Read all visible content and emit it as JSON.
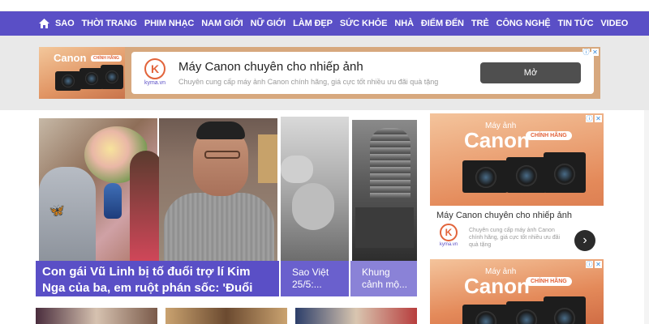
{
  "nav": {
    "items": [
      "SAO",
      "THỜI TRANG",
      "PHIM NHẠC",
      "NAM GIỚI",
      "NỮ GIỚI",
      "LÀM ĐẸP",
      "SỨC KHỎE",
      "NHÀ",
      "ĐIỂM ĐẾN",
      "TRẺ",
      "CÔNG NGHỆ",
      "TIN TỨC",
      "VIDEO"
    ],
    "home_icon": "home-icon",
    "bg_color": "#5a4fc6"
  },
  "top_ad": {
    "brand": "Canon",
    "badge": "CHÍNH HÃNG",
    "logo_letter": "K",
    "logo_text": "kyma.vn",
    "title": "Máy Canon chuyên cho nhiếp ảnh",
    "subtitle": "Chuyên cung cấp máy ảnh Canon chính hãng, giá cực tốt nhiều ưu đãi quà tặng",
    "open_label": "Mở"
  },
  "featured": {
    "main_caption": "Con gái Vũ Linh bị tố đuổi trợ lí Kim Nga của ba, em ruột phán sốc: 'Đuổi",
    "story_c_caption": "Sao Việt 25/5:...",
    "story_d_caption": "Khung cảnh mộ..."
  },
  "side_ad": {
    "small_label": "Máy ảnh",
    "brand": "Canon",
    "badge": "CHÍNH HÃNG",
    "title": "Máy Canon chuyên cho nhiếp ảnh",
    "description": "Chuyên cung cấp máy ảnh Canon chính hãng, giá cực tốt nhiều ưu đãi quà tặng",
    "logo_letter": "K",
    "logo_text": "kyma.vn"
  },
  "side_ad2": {
    "small_label": "Máy ảnh",
    "brand": "Canon",
    "badge": "CHÍNH HÃNG"
  },
  "colors": {
    "accent": "#5a4fc6",
    "ad_orange": "#e2643b"
  }
}
